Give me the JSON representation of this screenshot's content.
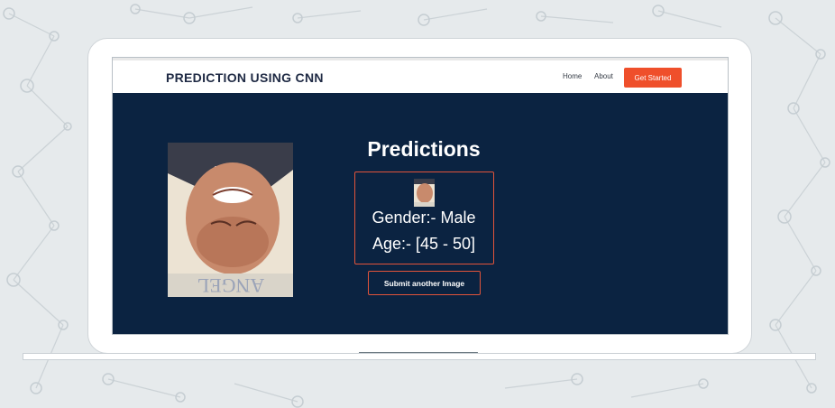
{
  "header": {
    "brand": "PREDICTION USING CNN"
  },
  "nav": {
    "home": "Home",
    "about": "About",
    "cta": "Get Started"
  },
  "main": {
    "title": "Predictions",
    "gender_text": "Gender:- Male",
    "age_text": "Age:- [45 - 50]",
    "submit_label": "Submit another Image"
  },
  "colors": {
    "screen_bg": "#0b2341",
    "accent": "#ef4f2b",
    "page_bg": "#e6eaec"
  }
}
